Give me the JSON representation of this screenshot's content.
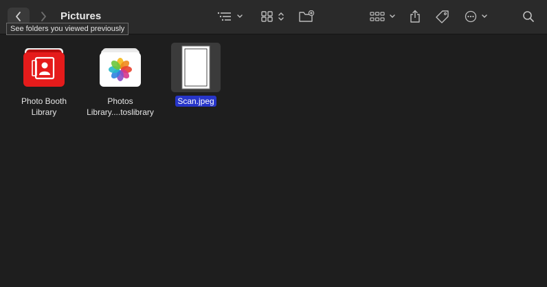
{
  "window": {
    "title": "Pictures"
  },
  "toolbar": {
    "back_tooltip": "See folders you viewed previously",
    "icons": [
      "chevron-left-icon",
      "chevron-right-icon",
      "list-view-icon",
      "grid-view-icon",
      "new-folder-icon",
      "group-icon",
      "share-icon",
      "tag-icon",
      "more-icon",
      "search-icon"
    ]
  },
  "items": [
    {
      "name_line1": "Photo Booth",
      "name_line2": "Library",
      "icon": "photo-booth-library-icon",
      "selected": false
    },
    {
      "name_line1": "Photos",
      "name_line2": "Library....toslibrary",
      "icon": "photos-library-icon",
      "selected": false
    },
    {
      "name_line1": "Scan.jpeg",
      "name_line2": "",
      "icon": "document-thumbnail-icon",
      "selected": true
    }
  ],
  "colors": {
    "background": "#1e1e1e",
    "toolbar": "#2a2a2a",
    "selection": "#2735c9"
  }
}
